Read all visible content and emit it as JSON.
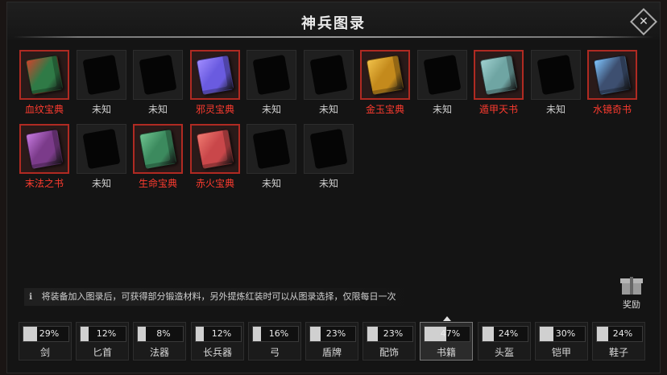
{
  "window": {
    "title": "神兵图录"
  },
  "items": [
    {
      "name": "血纹宝典",
      "known": true,
      "color": "#2f7a46",
      "accent": "#d0432c",
      "icon": "book-blood-pattern"
    },
    {
      "name": "未知",
      "known": false
    },
    {
      "name": "未知",
      "known": false
    },
    {
      "name": "邪灵宝典",
      "known": true,
      "color": "#6a5be0",
      "accent": "#a08cff",
      "icon": "book-evil-spirit"
    },
    {
      "name": "未知",
      "known": false
    },
    {
      "name": "未知",
      "known": false
    },
    {
      "name": "金玉宝典",
      "known": true,
      "color": "#c48a1c",
      "accent": "#f1c24a",
      "icon": "book-gold-jade"
    },
    {
      "name": "未知",
      "known": false
    },
    {
      "name": "遁甲天书",
      "known": true,
      "color": "#6fa5a3",
      "accent": "#9fd0cf",
      "icon": "book-heavenly"
    },
    {
      "name": "未知",
      "known": false
    },
    {
      "name": "水镜奇书",
      "known": true,
      "color": "#3d4f70",
      "accent": "#7fc5ff",
      "icon": "book-water-mirror"
    },
    {
      "name": "末法之书",
      "known": true,
      "color": "#7b3b8a",
      "accent": "#c77be0",
      "icon": "book-final-dharma"
    },
    {
      "name": "未知",
      "known": false
    },
    {
      "name": "生命宝典",
      "known": true,
      "color": "#3c8a5e",
      "accent": "#6ec38f",
      "icon": "book-life"
    },
    {
      "name": "赤火宝典",
      "known": true,
      "color": "#c9474a",
      "accent": "#f07a70",
      "icon": "book-red-fire"
    },
    {
      "name": "未知",
      "known": false
    },
    {
      "name": "未知",
      "known": false
    }
  ],
  "notice": {
    "icon": "info-icon",
    "text": "将装备加入图录后，可获得部分锻造材料，另外提炼红装时可以从图录选择，仅限每日一次"
  },
  "reward": {
    "label": "奖励",
    "icon": "gift-icon"
  },
  "tabs": [
    {
      "label": "剑",
      "pct": "29%",
      "progress": 0.29,
      "active": false
    },
    {
      "label": "匕首",
      "pct": "12%",
      "progress": 0.12,
      "active": false
    },
    {
      "label": "法器",
      "pct": "8%",
      "progress": 0.08,
      "active": false
    },
    {
      "label": "长兵器",
      "pct": "12%",
      "progress": 0.12,
      "active": false
    },
    {
      "label": "弓",
      "pct": "16%",
      "progress": 0.16,
      "active": false
    },
    {
      "label": "盾牌",
      "pct": "23%",
      "progress": 0.23,
      "active": false
    },
    {
      "label": "配饰",
      "pct": "23%",
      "progress": 0.23,
      "active": false
    },
    {
      "label": "书籍",
      "pct": "47%",
      "progress": 0.47,
      "active": true
    },
    {
      "label": "头盔",
      "pct": "24%",
      "progress": 0.24,
      "active": false
    },
    {
      "label": "铠甲",
      "pct": "30%",
      "progress": 0.3,
      "active": false
    },
    {
      "label": "鞋子",
      "pct": "24%",
      "progress": 0.24,
      "active": false
    }
  ]
}
